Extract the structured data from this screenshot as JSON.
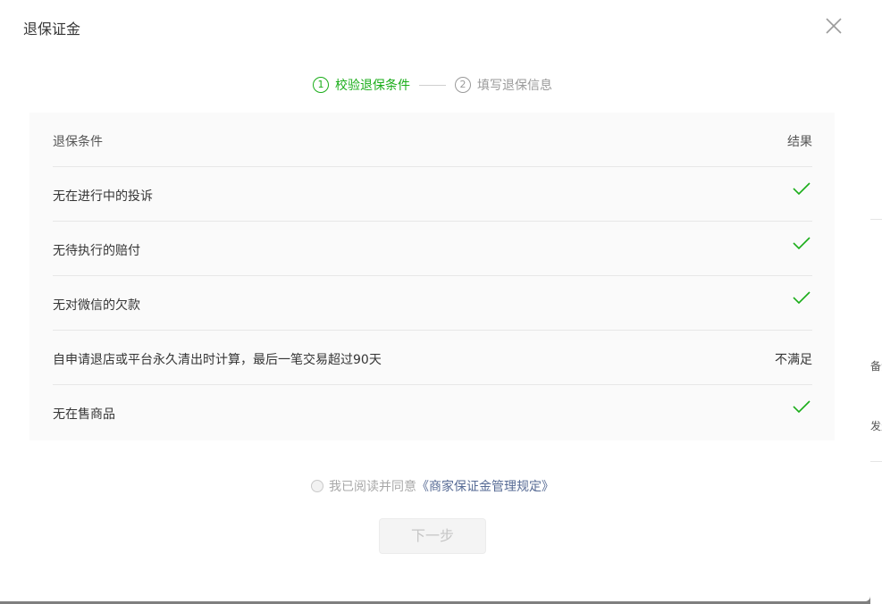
{
  "dialog": {
    "title": "退保证金",
    "close_icon": "close-icon"
  },
  "steps": [
    {
      "num": "1",
      "label": "校验退保条件",
      "state": "active"
    },
    {
      "num": "2",
      "label": "填写退保信息",
      "state": "pending"
    }
  ],
  "table": {
    "headers": {
      "condition": "退保条件",
      "result": "结果"
    },
    "rows": [
      {
        "condition": "无在进行中的投诉",
        "result": "",
        "passed": true
      },
      {
        "condition": "无待执行的赔付",
        "result": "",
        "passed": true
      },
      {
        "condition": "无对微信的欠款",
        "result": "",
        "passed": true
      },
      {
        "condition": "自申请退店或平台永久清出时计算，最后一笔交易超过90天",
        "result": "不满足",
        "passed": false
      },
      {
        "condition": "无在售商品",
        "result": "",
        "passed": true
      }
    ]
  },
  "agreement": {
    "text": "我已阅读并同意",
    "link": "《商家保证金管理规定》",
    "checked": false
  },
  "next_button": {
    "label": "下一步",
    "enabled": false
  },
  "colors": {
    "accent": "#1aad19",
    "link": "#576b95",
    "muted": "#9a9a9a"
  },
  "backdrop": {
    "fragment_1": "备注",
    "fragment_2": "发生"
  }
}
